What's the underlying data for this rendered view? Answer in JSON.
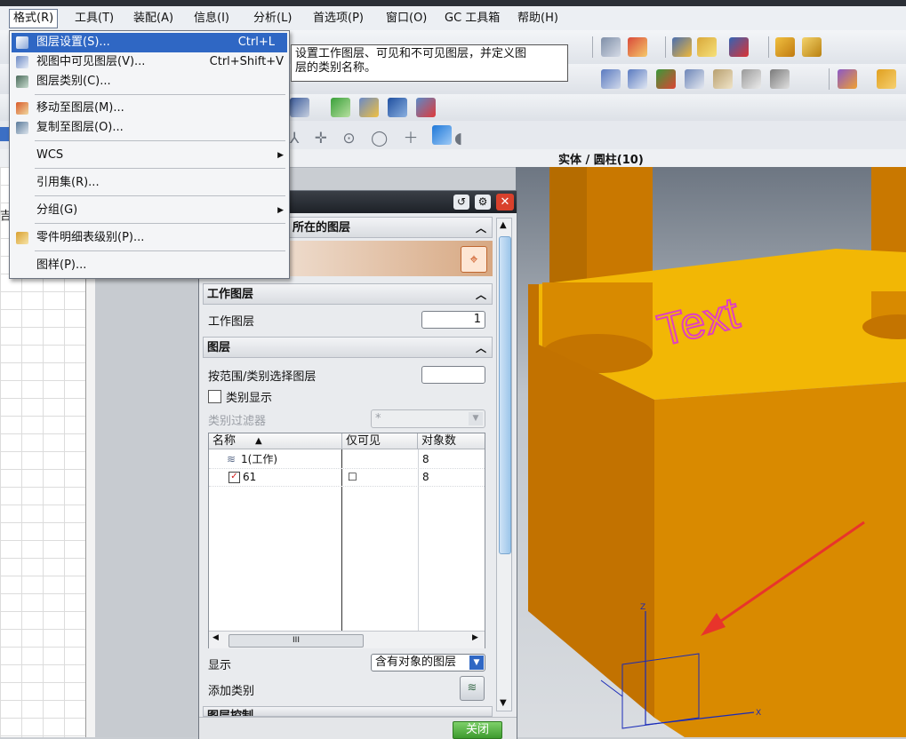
{
  "menubar": {
    "items": [
      "格式(R)",
      "工具(T)",
      "装配(A)",
      "信息(I)",
      "分析(L)",
      "首选项(P)",
      "窗口(O)",
      "GC 工具箱",
      "帮助(H)"
    ]
  },
  "format_menu": {
    "items": [
      {
        "label": "图层设置(S)...",
        "shortcut": "Ctrl+L",
        "icon": "layer-settings-icon"
      },
      {
        "label": "视图中可见图层(V)...",
        "shortcut": "Ctrl+Shift+V",
        "icon": "visible-layers-icon"
      },
      {
        "label": "图层类别(C)...",
        "shortcut": "",
        "icon": "layer-category-icon"
      },
      {
        "label": "移动至图层(M)...",
        "shortcut": "",
        "icon": "move-to-layer-icon"
      },
      {
        "label": "复制至图层(O)...",
        "shortcut": "",
        "icon": "copy-to-layer-icon"
      },
      {
        "label": "WCS",
        "shortcut": "",
        "icon": "",
        "submenu": true
      },
      {
        "label": "引用集(R)...",
        "shortcut": "",
        "icon": ""
      },
      {
        "label": "分组(G)",
        "shortcut": "",
        "icon": "",
        "submenu": true
      },
      {
        "label": "零件明细表级别(P)...",
        "shortcut": "",
        "icon": "parts-list-icon"
      },
      {
        "label": "图样(P)...",
        "shortcut": "",
        "icon": ""
      }
    ]
  },
  "tooltip": {
    "line1": "设置工作图层、可见和不可见图层，并定义图",
    "line2": "层的类别名称。"
  },
  "status": {
    "selection": "实体 / 圆柱(10)"
  },
  "viewport": {
    "embossed_text": "Text"
  },
  "left_pane": {
    "partial_text": "吉"
  },
  "dialog": {
    "section_object_layer": "所在的图层",
    "section_work_layer": "工作图层",
    "work_layer_label": "工作图层",
    "work_layer_value": "1",
    "section_layers": "图层",
    "select_by_range_label": "按范围/类别选择图层",
    "category_display_label": "类别显示",
    "category_filter_label": "类别过滤器",
    "category_filter_value": "*",
    "columns": [
      "名称",
      "仅可见",
      "对象数"
    ],
    "rows": [
      {
        "name": "1(工作)",
        "visible_only": "",
        "count": "8"
      },
      {
        "name": "61",
        "visible_only": "☐",
        "count": "8"
      }
    ],
    "display_label": "显示",
    "display_value": "含有对象的图层",
    "add_category_label": "添加类别",
    "section_layer_control": "图层控制",
    "close_button": "关闭"
  },
  "colors": {
    "part_body": "#d98a00",
    "part_top": "#f2b705",
    "text_emboss": "#e040c0",
    "arrow": "#e8342b",
    "highlight": "#2f67c4"
  }
}
